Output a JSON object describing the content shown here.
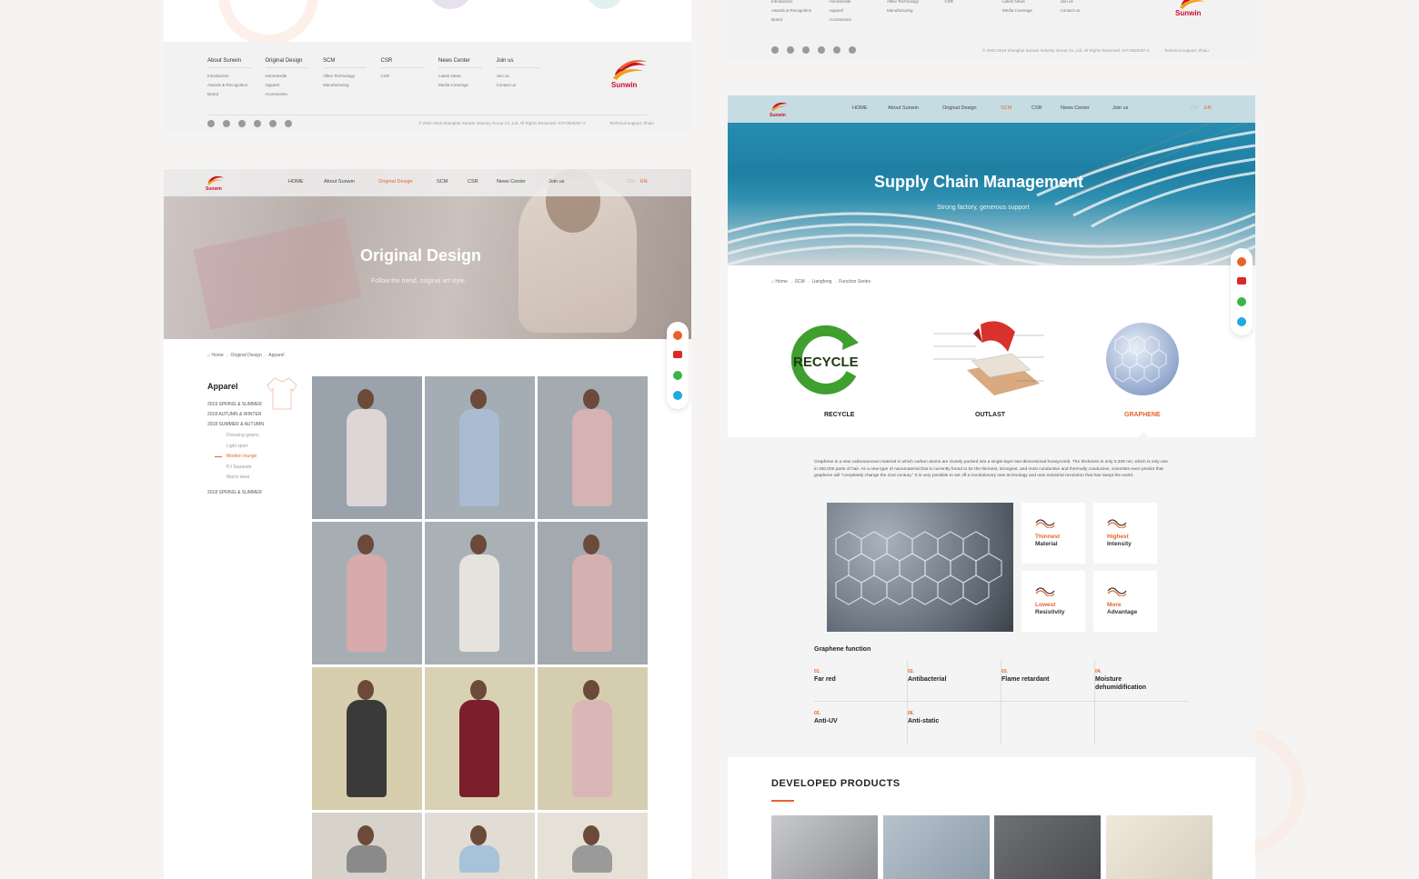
{
  "brand": {
    "name": "Sunwin",
    "primary": "#c8102e",
    "accent": "#e8632b"
  },
  "footer": {
    "columns": [
      {
        "heading": "About Sunwin",
        "items": [
          "Introduction",
          "Awards & Recognition",
          "Brand"
        ]
      },
      {
        "heading": "Original Design",
        "items": [
          "Hometextile",
          "Apparel",
          "Accessories"
        ]
      },
      {
        "heading": "SCM",
        "items": [
          "Alltex Technology",
          "Manufacturing"
        ]
      },
      {
        "heading": "CSR",
        "items": [
          "CSR"
        ]
      },
      {
        "heading": "News Center",
        "items": [
          "Latest News",
          "Media Coverage"
        ]
      },
      {
        "heading": "Join us",
        "items": [
          "Join us",
          "Contact us"
        ]
      }
    ],
    "social_icons": [
      "twitter-icon",
      "weibo-icon",
      "facebook-icon",
      "instagram-icon",
      "wechat-icon",
      "qq-icon"
    ],
    "copyright": "© 2002-2016 Shanghai Sunwin Industry Group Co.,Ltd. All Rights Reserved. ICP:0825297-2",
    "tech_support": "Technical support: Zhulu"
  },
  "nav": {
    "items": [
      "HOME",
      "About Sunwin",
      "Original Design",
      "SCM",
      "CSR",
      "News Center",
      "Join us"
    ],
    "lang": [
      "CN",
      "EN"
    ]
  },
  "design_page": {
    "hero_title": "Original Design",
    "hero_subtitle": "Follow the trend, original art style.",
    "breadcrumb": [
      "Home",
      "Original Design",
      "Apparel"
    ],
    "sidebar": {
      "title": "Apparel",
      "items": [
        "2019 SPRING & SUMMER",
        "2018 AUTUMN & WINTER",
        "2018 SUMMER & AUTUMN",
        "2018 SPRING & SUMMER"
      ],
      "subitems": [
        "Dressing gowns",
        "Light sport",
        "Modern lounge",
        "PJ Separate",
        "Man's wear"
      ],
      "active_sub": "Modern lounge"
    }
  },
  "scm_page": {
    "hero_title": "Supply Chain Management",
    "hero_subtitle": "Strong factory, generous support",
    "breadcrumb": [
      "Home",
      "SCM",
      "Liangfeng",
      "Function Series"
    ],
    "features": [
      "RECYCLE",
      "OUTLAST",
      "GRAPHENE"
    ],
    "active_feature": "GRAPHENE",
    "recycle_word": "RECYCLE",
    "description": "Graphene is a new carbonaceous material in which carbon atoms are closely packed into a single-layer two-dimensional honeycomb. The thickness is only 0.335 nm, which is only one in 200,000 parts of hair. As a new type of nanomaterial that is currently found to be the thinnest, strongest, and most conductive and thermally conductive, scientists even predict that graphene will \"completely change the 21st century.\" It is very possible to set off a revolutionary new technology and new industrial revolution that has swept the world.",
    "cards": [
      {
        "top": "Thinnest",
        "bottom": "Material"
      },
      {
        "top": "Highest",
        "bottom": "Intensity"
      },
      {
        "top": "Lowest",
        "bottom": "Resistivity"
      },
      {
        "top": "More",
        "bottom": "Advantage"
      }
    ],
    "function_heading": "Graphene function",
    "functions": [
      {
        "num": "01.",
        "label": "Far red"
      },
      {
        "num": "02.",
        "label": "Antibacterial"
      },
      {
        "num": "03.",
        "label": "Flame retardant"
      },
      {
        "num": "04.",
        "label": "Moisture dehumidification"
      },
      {
        "num": "05.",
        "label": "Anti-UV"
      },
      {
        "num": "06.",
        "label": "Anti-static"
      }
    ],
    "developed_heading": "DEVELOPED PRODUCTS"
  }
}
